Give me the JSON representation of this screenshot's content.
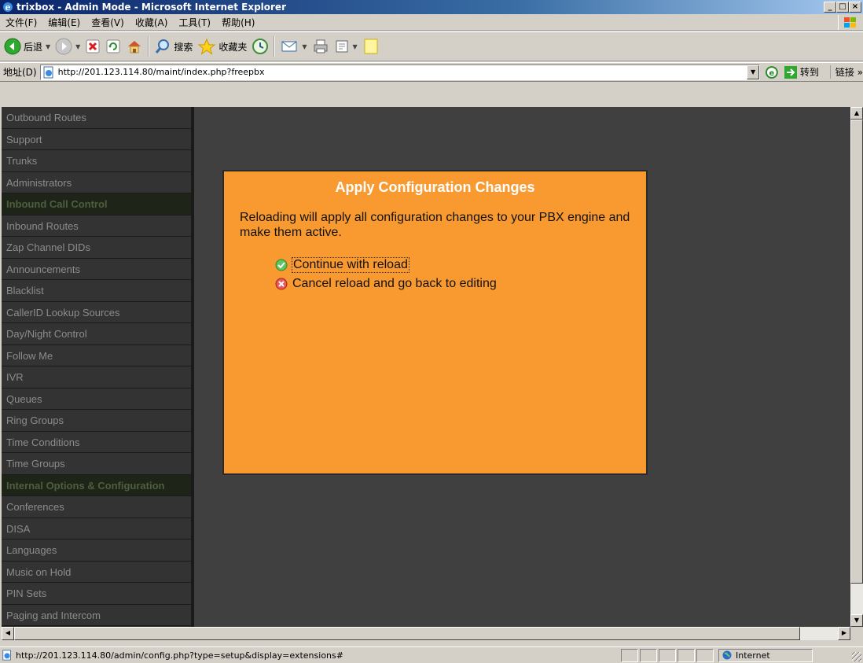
{
  "window": {
    "title": "trixbox - Admin Mode - Microsoft Internet Explorer",
    "controls": [
      "_",
      "□",
      "×"
    ]
  },
  "menubar": {
    "items": [
      "文件(F)",
      "编辑(E)",
      "查看(V)",
      "收藏(A)",
      "工具(T)",
      "帮助(H)"
    ]
  },
  "toolbar": {
    "back_label": "后退",
    "search_label": "搜索",
    "favorites_label": "收藏夹"
  },
  "addressbar": {
    "label": "地址(D)",
    "url": "http://201.123.114.80/maint/index.php?freepbx",
    "go_label": "转到",
    "links_label": "链接 »"
  },
  "sidebar": {
    "items": [
      {
        "label": "Outbound Routes",
        "type": "item"
      },
      {
        "label": "Support",
        "type": "item"
      },
      {
        "label": "Trunks",
        "type": "item"
      },
      {
        "label": "Administrators",
        "type": "item"
      },
      {
        "label": "Inbound Call Control",
        "type": "header"
      },
      {
        "label": "Inbound Routes",
        "type": "item"
      },
      {
        "label": "Zap Channel DIDs",
        "type": "item"
      },
      {
        "label": "Announcements",
        "type": "item"
      },
      {
        "label": "Blacklist",
        "type": "item"
      },
      {
        "label": "CallerID Lookup Sources",
        "type": "item"
      },
      {
        "label": "Day/Night Control",
        "type": "item"
      },
      {
        "label": "Follow Me",
        "type": "item"
      },
      {
        "label": "IVR",
        "type": "item"
      },
      {
        "label": "Queues",
        "type": "item"
      },
      {
        "label": "Ring Groups",
        "type": "item"
      },
      {
        "label": "Time Conditions",
        "type": "item"
      },
      {
        "label": "Time Groups",
        "type": "item"
      },
      {
        "label": "Internal Options & Configuration",
        "type": "header"
      },
      {
        "label": "Conferences",
        "type": "item"
      },
      {
        "label": "DISA",
        "type": "item"
      },
      {
        "label": "Languages",
        "type": "item"
      },
      {
        "label": "Music on Hold",
        "type": "item"
      },
      {
        "label": "PIN Sets",
        "type": "item"
      },
      {
        "label": "Paging and Intercom",
        "type": "item"
      }
    ]
  },
  "dialog": {
    "title": "Apply Configuration Changes",
    "message": "Reloading will apply all configuration changes to your PBX engine and make them active.",
    "continue_label": "Continue with reload",
    "cancel_label": "Cancel reload and go back to editing",
    "color": "#f99a31"
  },
  "statusbar": {
    "url": "http://201.123.114.80/admin/config.php?type=setup&display=extensions#",
    "zone": "Internet"
  }
}
